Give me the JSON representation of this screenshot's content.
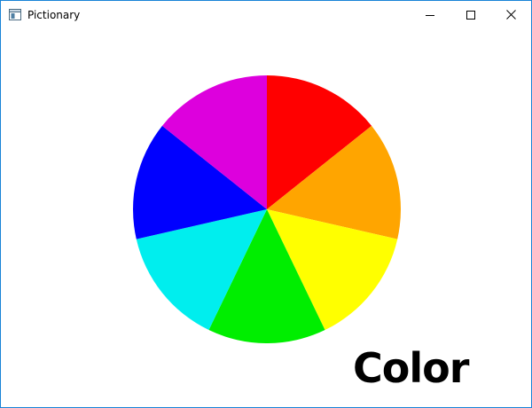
{
  "window": {
    "title": "Pictionary",
    "frame_color": "#1883d7",
    "controls": {
      "minimize_icon": "minimize-icon",
      "maximize_icon": "maximize-icon",
      "close_icon": "close-icon"
    }
  },
  "wheel": {
    "segments": [
      {
        "color": "#ff0000"
      },
      {
        "color": "#ffa500"
      },
      {
        "color": "#ffff00"
      },
      {
        "color": "#00ee00"
      },
      {
        "color": "#00eeee"
      },
      {
        "color": "#0000ff"
      },
      {
        "color": "#dd00dd"
      }
    ]
  },
  "word": "Color"
}
